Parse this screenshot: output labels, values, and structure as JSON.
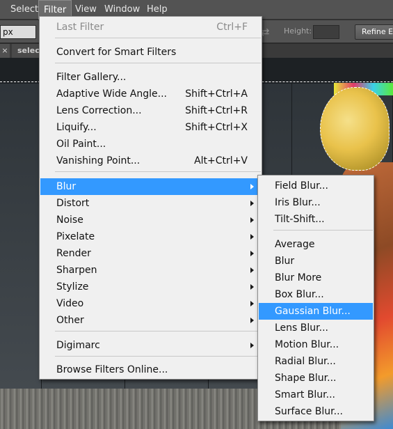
{
  "menubar": {
    "items": [
      "Select",
      "Filter",
      "View",
      "Window",
      "Help"
    ],
    "active": "Filter"
  },
  "options_bar": {
    "unit_value": "px",
    "height_label": "Height:",
    "refine_button": "Refine Ed"
  },
  "doc_tab": {
    "close_glyph": "×",
    "title": "select"
  },
  "filter_menu": {
    "last_filter": {
      "label": "Last Filter",
      "shortcut": "Ctrl+F",
      "disabled": true
    },
    "convert": "Convert for Smart Filters",
    "gallery_items": [
      {
        "label": "Filter Gallery...",
        "shortcut": ""
      },
      {
        "label": "Adaptive Wide Angle...",
        "shortcut": "Shift+Ctrl+A"
      },
      {
        "label": "Lens Correction...",
        "shortcut": "Shift+Ctrl+R"
      },
      {
        "label": "Liquify...",
        "shortcut": "Shift+Ctrl+X"
      },
      {
        "label": "Oil Paint...",
        "shortcut": ""
      },
      {
        "label": "Vanishing Point...",
        "shortcut": "Alt+Ctrl+V"
      }
    ],
    "submenus": [
      "Blur",
      "Distort",
      "Noise",
      "Pixelate",
      "Render",
      "Sharpen",
      "Stylize",
      "Video",
      "Other"
    ],
    "highlighted_submenu": "Blur",
    "digimarc": "Digimarc",
    "browse": "Browse Filters Online..."
  },
  "blur_menu": {
    "gallery_items": [
      "Field Blur...",
      "Iris Blur...",
      "Tilt-Shift..."
    ],
    "items": [
      "Average",
      "Blur",
      "Blur More",
      "Box Blur...",
      "Gaussian Blur...",
      "Lens Blur...",
      "Motion Blur...",
      "Radial Blur...",
      "Shape Blur...",
      "Smart Blur...",
      "Surface Blur..."
    ],
    "highlighted_item": "Gaussian Blur..."
  },
  "colors": {
    "highlight": "#3399ff",
    "menu_background": "#f0f0f0",
    "menubar_background": "#535353"
  }
}
